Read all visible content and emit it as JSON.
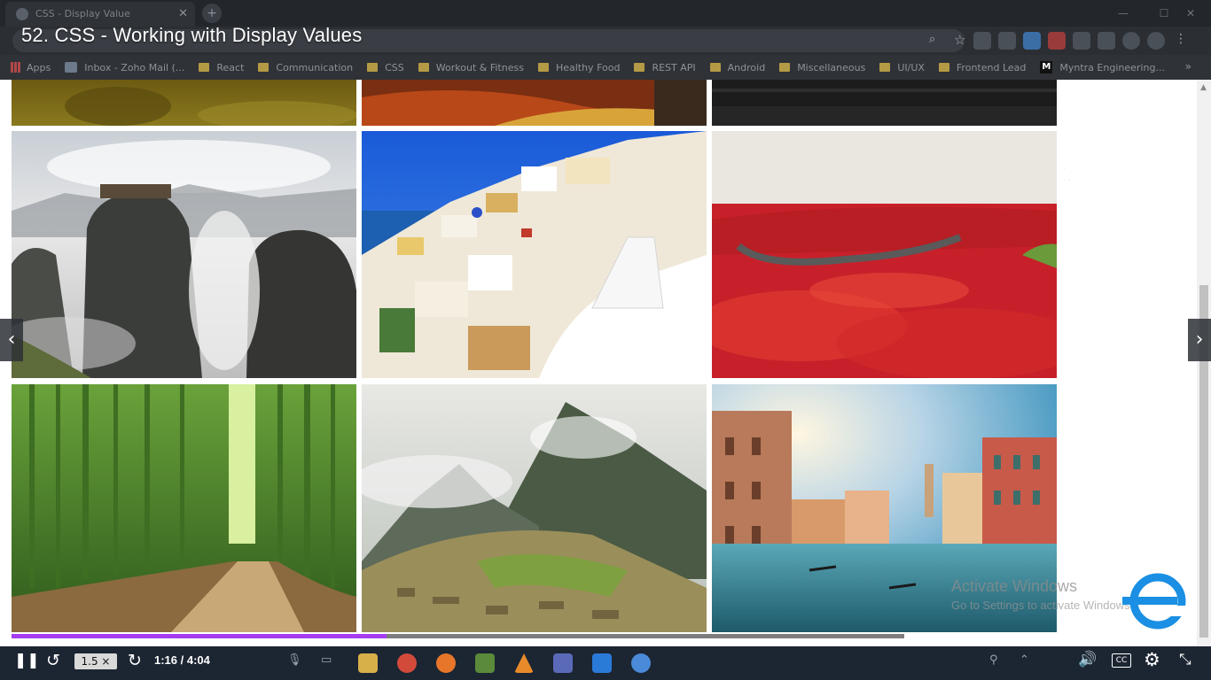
{
  "browser": {
    "tab_title": "CSS - Display Value",
    "bookmarks": [
      {
        "label": "Apps",
        "icon": "apps-grid-icon"
      },
      {
        "label": "Inbox - Zoho Mail (...",
        "icon": "mail-icon"
      },
      {
        "label": "React",
        "icon": "folder-icon"
      },
      {
        "label": "Communication",
        "icon": "folder-icon"
      },
      {
        "label": "CSS",
        "icon": "folder-icon"
      },
      {
        "label": "Workout & Fitness",
        "icon": "folder-icon"
      },
      {
        "label": "Healthy Food",
        "icon": "folder-icon"
      },
      {
        "label": "REST API",
        "icon": "folder-icon"
      },
      {
        "label": "Android",
        "icon": "folder-icon"
      },
      {
        "label": "Miscellaneous",
        "icon": "folder-icon"
      },
      {
        "label": "UI/UX",
        "icon": "folder-icon"
      },
      {
        "label": "Frontend Lead",
        "icon": "folder-icon"
      },
      {
        "label": "Myntra Engineering...",
        "icon": "myntra-icon"
      }
    ]
  },
  "video": {
    "title": "52. CSS - Working with Display Values",
    "speed": "1.5 ×",
    "time": "1:16 / 4:04",
    "progress_fraction": 0.42,
    "cc_label": "CC"
  },
  "watermark": {
    "line1": "Activate Windows",
    "line2": "Go to Settings to activate Windows."
  },
  "colors": {
    "progress": "#a63cf0",
    "player_bar": "#1c2532",
    "logo_blue": "#1a8fe3"
  }
}
